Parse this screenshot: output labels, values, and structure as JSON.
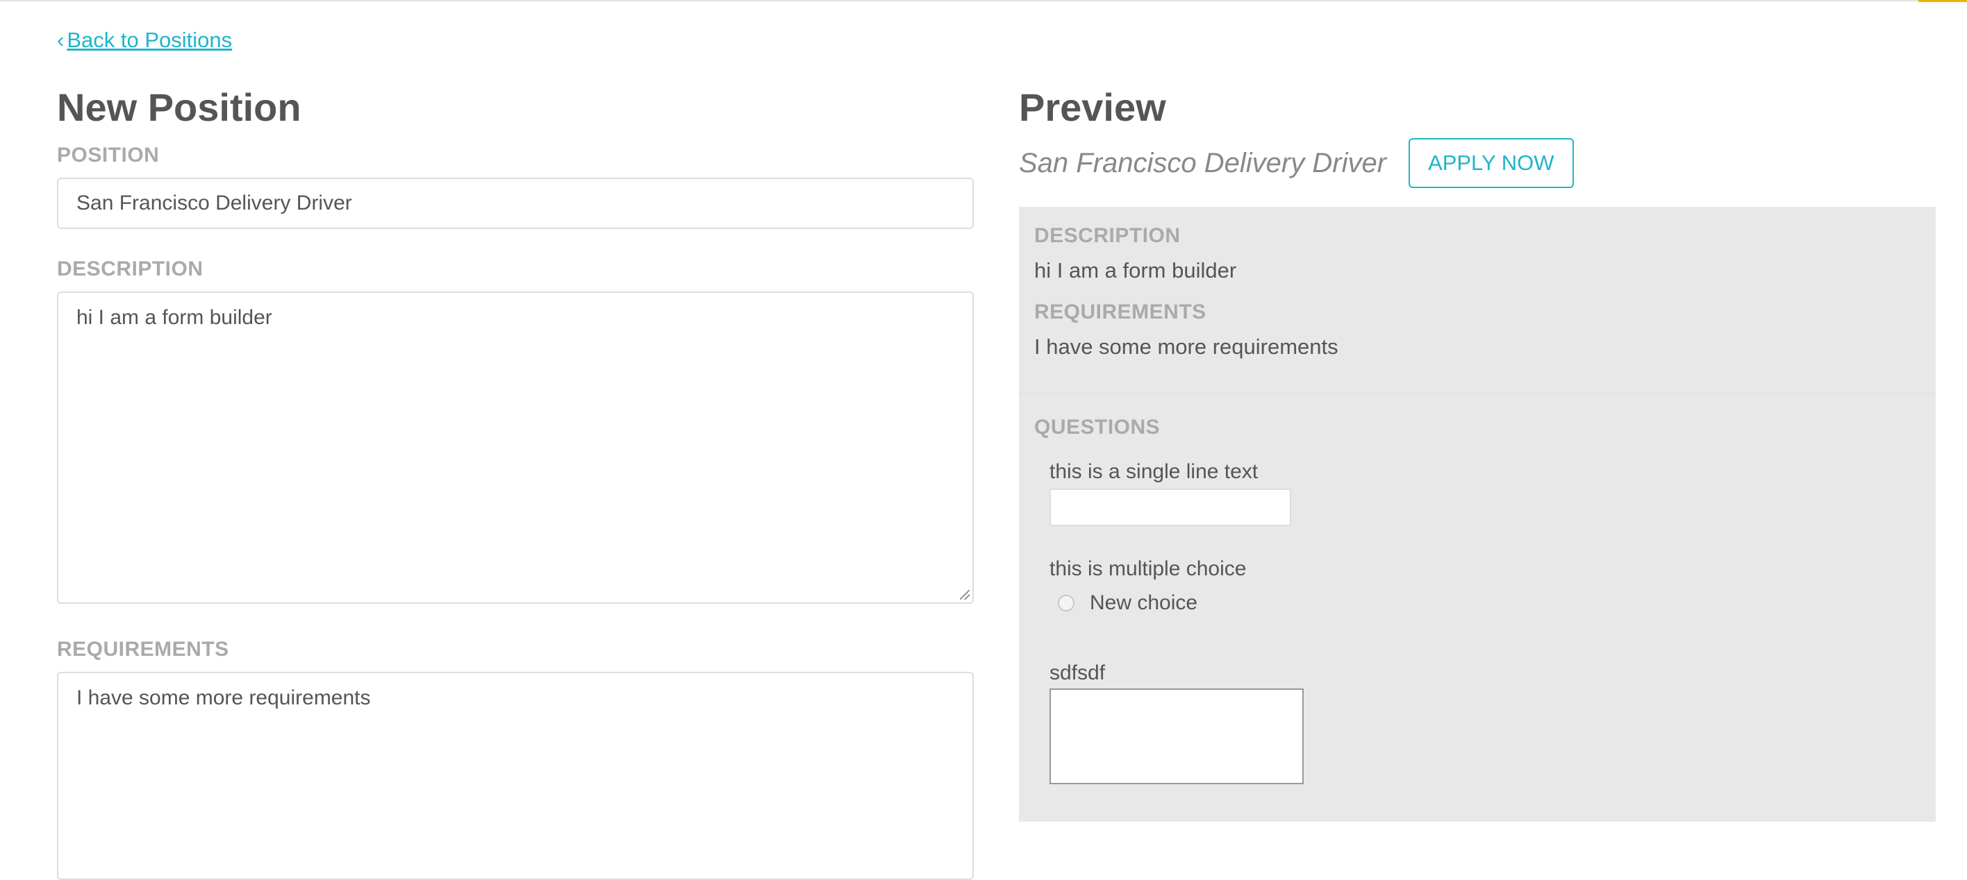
{
  "nav": {
    "back_chevron": "‹",
    "back_label": "Back to Positions"
  },
  "form": {
    "title": "New Position",
    "position_label": "POSITION",
    "position_value": "San Francisco Delivery Driver",
    "description_label": "DESCRIPTION",
    "description_value": "hi I am a form builder",
    "requirements_label": "REQUIREMENTS",
    "requirements_value": "I have some more requirements"
  },
  "preview": {
    "title": "Preview",
    "position_title": "San Francisco Delivery Driver",
    "apply_label": "APPLY NOW",
    "description_label": "DESCRIPTION",
    "description_text": "hi I am a form builder",
    "requirements_label": "REQUIREMENTS",
    "requirements_text": "I have some more requirements",
    "questions_label": "QUESTIONS",
    "questions": [
      {
        "label": "this is a single line text",
        "type": "text"
      },
      {
        "label": "this is multiple choice",
        "type": "radio",
        "options": [
          "New choice"
        ]
      },
      {
        "label": "sdfsdf",
        "type": "textarea"
      }
    ]
  },
  "colors": {
    "accent": "#1fb5c9",
    "label_gray": "#aaaaaa",
    "panel_bg": "#e8e8e8",
    "top_accent": "#f0b400"
  }
}
